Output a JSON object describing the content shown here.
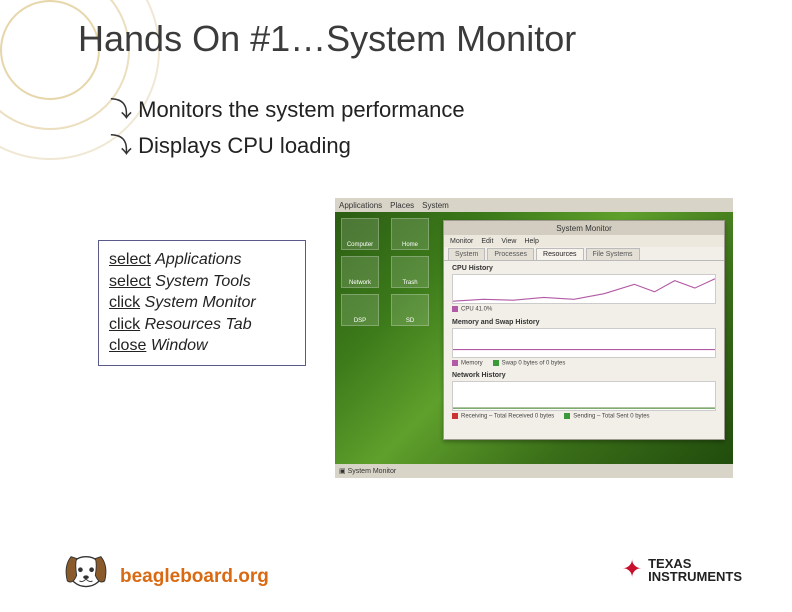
{
  "slide": {
    "title": "Hands On #1…System Monitor",
    "bullets": [
      "Monitors the system performance",
      "Displays CPU loading"
    ]
  },
  "instructions": [
    {
      "verb": "select",
      "object": "Applications"
    },
    {
      "verb": "select",
      "object": "System Tools"
    },
    {
      "verb": "click",
      "object": "System Monitor"
    },
    {
      "verb": "click",
      "object": "Resources Tab"
    },
    {
      "verb": "close",
      "object": "Window"
    }
  ],
  "screenshot": {
    "topbar": {
      "items": [
        "Applications",
        "Places",
        "System"
      ]
    },
    "desktop_icons": [
      "Computer",
      "Home",
      "Network",
      "Trash",
      "DSP",
      "SD"
    ],
    "window": {
      "title": "System Monitor",
      "menu": [
        "Monitor",
        "Edit",
        "View",
        "Help"
      ],
      "tabs": [
        "System",
        "Processes",
        "Resources",
        "File Systems"
      ],
      "active_tab": "Resources",
      "sections": {
        "cpu": {
          "title": "CPU History",
          "legend": [
            {
              "color": "#b25aa5",
              "label": "CPU 41.0%"
            }
          ]
        },
        "memory": {
          "title": "Memory and Swap History",
          "legend": [
            {
              "color": "#b25aa5",
              "label": "Memory"
            },
            {
              "color": "#3a9a3a",
              "label": "Swap 0 bytes of 0 bytes"
            }
          ]
        },
        "network": {
          "title": "Network History",
          "legend": [
            {
              "color": "#cc3333",
              "label": "Receiving – Total Received 0 bytes"
            },
            {
              "color": "#3a9a3a",
              "label": "Sending – Total Sent 0 bytes"
            }
          ]
        }
      }
    },
    "taskbar": {
      "items": [
        "System Monitor"
      ]
    }
  },
  "logos": {
    "beagleboard": "beagleboard.org",
    "ti_line1": "TEXAS",
    "ti_line2": "INSTRUMENTS"
  }
}
